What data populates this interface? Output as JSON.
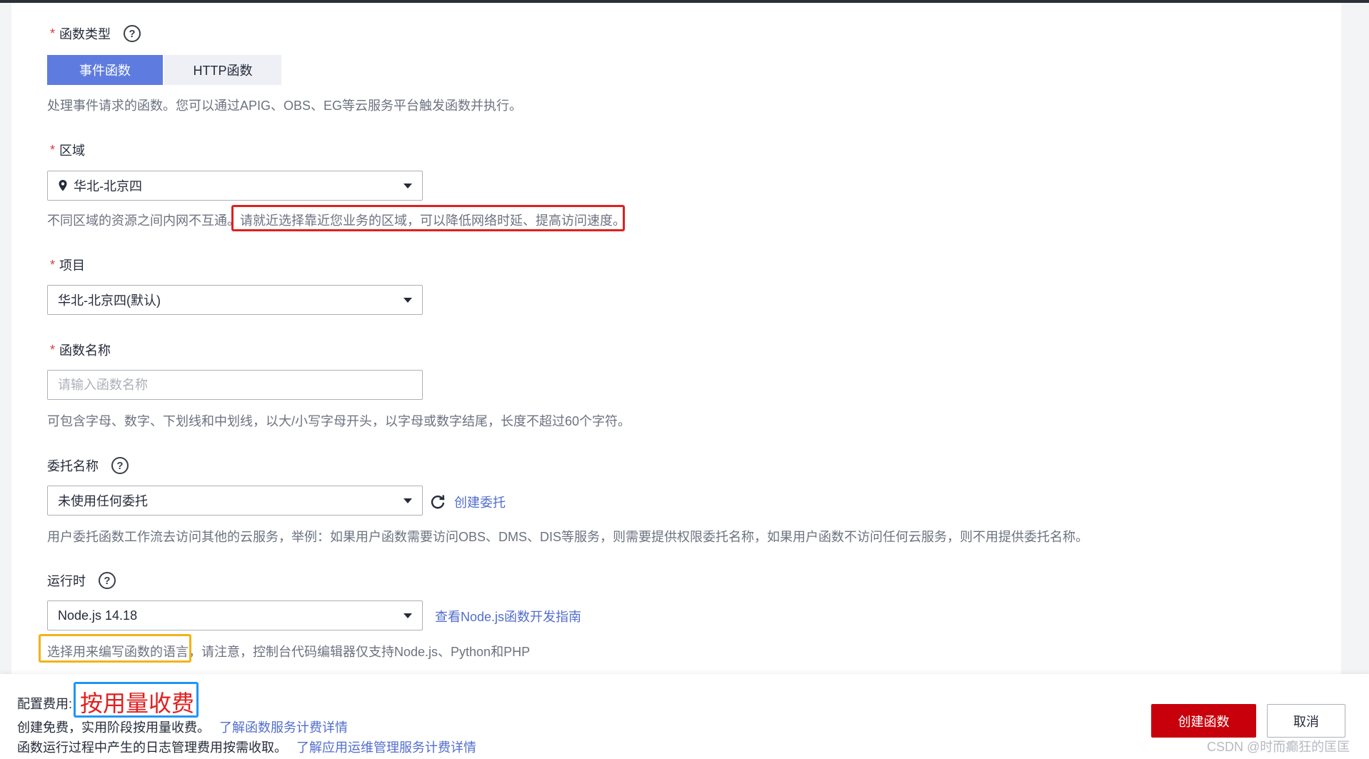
{
  "func_type": {
    "label": "函数类型",
    "tabs": [
      {
        "label": "事件函数",
        "active": true
      },
      {
        "label": "HTTP函数",
        "active": false
      }
    ],
    "hint": "处理事件请求的函数。您可以通过APIG、OBS、EG等云服务平台触发函数并执行。"
  },
  "region": {
    "label": "区域",
    "value": "华北-北京四",
    "hint_prefix": "不同区域的资源之间内网不互通。",
    "hint_highlight": "请就近选择靠近您业务的区域，可以降低网络时延、提高访问速度。"
  },
  "project": {
    "label": "项目",
    "value": "华北-北京四(默认)"
  },
  "func_name": {
    "label": "函数名称",
    "placeholder": "请输入函数名称",
    "value": "",
    "hint": "可包含字母、数字、下划线和中划线，以大/小写字母开头，以字母或数字结尾，长度不超过60个字符。"
  },
  "agency": {
    "label": "委托名称",
    "value": "未使用任何委托",
    "create_link": "创建委托",
    "hint": "用户委托函数工作流去访问其他的云服务，举例：如果用户函数需要访问OBS、DMS、DIS等服务，则需要提供权限委托名称，如果用户函数不访问任何云服务，则不用提供委托名称。"
  },
  "runtime": {
    "label": "运行时",
    "value": "Node.js 14.18",
    "guide_link": "查看Node.js函数开发指南",
    "hint_highlight": "选择用来编写函数的语言",
    "hint_suffix": "，请注意，控制台代码编辑器仅支持Node.js、Python和PHP"
  },
  "footer": {
    "fee_label": "配置费用:",
    "fee_value": "按用量收费",
    "line1_text": "创建免费，实用阶段按用量收费。",
    "line1_link": "了解函数服务计费详情",
    "line2_text": "函数运行过程中产生的日志管理费用按需收取。",
    "line2_link": "了解应用运维管理服务计费详情",
    "create_button": "创建函数",
    "cancel_button": "取消",
    "watermark": "CSDN @时而癫狂的匡匡"
  },
  "colors": {
    "primary_tab": "#5e7ce0",
    "create_button": "#c7000b",
    "link": "#526ecc",
    "annotation_red": "#e0201f",
    "annotation_orange": "#f2b318",
    "annotation_blue": "#2196f3",
    "fee_text": "#e0201f"
  }
}
